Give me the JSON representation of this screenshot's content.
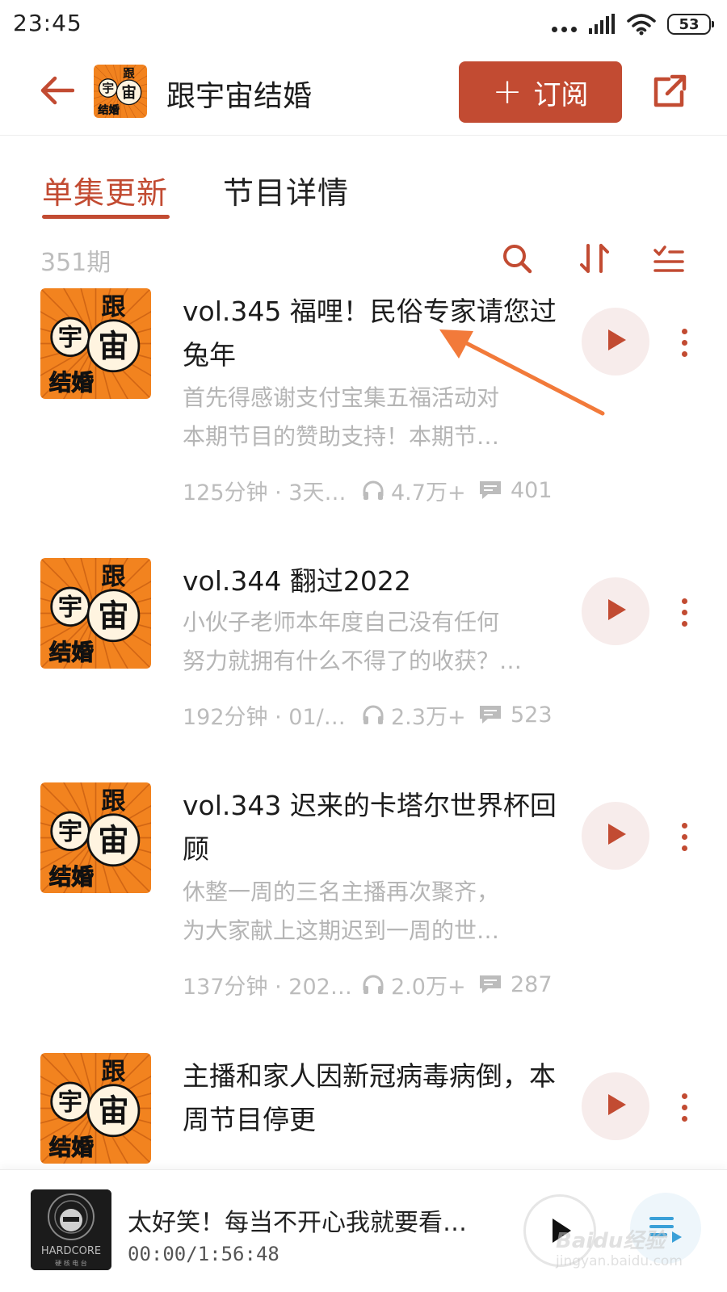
{
  "status_bar": {
    "time": "23:45",
    "battery": "53",
    "signal_icon": "signal-bars-icon",
    "wifi_icon": "wifi-icon"
  },
  "header": {
    "title": "跟宇宙结婚",
    "subscribe_label": "订阅",
    "back_icon": "back-arrow-icon",
    "share_icon": "share-icon"
  },
  "cover_art": {
    "chars": [
      "跟",
      "宇",
      "宙",
      "结婚"
    ],
    "bg_color": "#f2831f",
    "text_color": "#111111"
  },
  "tabs": [
    {
      "label": "单集更新",
      "active": true
    },
    {
      "label": "节目详情",
      "active": false
    }
  ],
  "list_toolbar": {
    "count": "351期",
    "icons": [
      "search-icon",
      "sort-icon",
      "multi-select-icon"
    ]
  },
  "episodes": [
    {
      "title": "vol.345 福哩！民俗专家请您过兔年",
      "desc_lines": [
        "首先得感谢支付宝集五福活动对",
        "本期节目的赞助支持！本期节…"
      ],
      "duration": "125分钟 · 3天…",
      "plays": "4.7万+",
      "comments": "401"
    },
    {
      "title": "vol.344 翻过2022",
      "desc_lines": [
        "小伙子老师本年度自己没有任何",
        "努力就拥有什么不得了的收获？…"
      ],
      "duration": "192分钟 · 01/…",
      "plays": "2.3万+",
      "comments": "523"
    },
    {
      "title": "vol.343 迟来的卡塔尔世界杯回顾",
      "desc_lines": [
        "休整一周的三名主播再次聚齐，",
        "为大家献上这期迟到一周的世…"
      ],
      "duration": "137分钟 · 202…",
      "plays": "2.0万+",
      "comments": "287"
    },
    {
      "title": "主播和家人因新冠病毒病倒，本周节目停更",
      "desc_lines": [],
      "duration": "",
      "plays": "",
      "comments": ""
    }
  ],
  "mini_player": {
    "title": "太好笑！每当不开心我就要看…",
    "time": "00:00/1:56:48",
    "cover_text": "HARDCORE",
    "cover_subtext": "硬 核 电 台",
    "play_icon": "play-icon",
    "playlist_icon": "playlist-icon"
  },
  "watermark": {
    "text": "Baidu经验",
    "sub": "jingyan.baidu.com"
  },
  "colors": {
    "accent": "#c24b32",
    "muted_text": "#b5b5b5",
    "play_button_bg": "#f7eceb",
    "annotation_arrow": "#f27a3a"
  }
}
